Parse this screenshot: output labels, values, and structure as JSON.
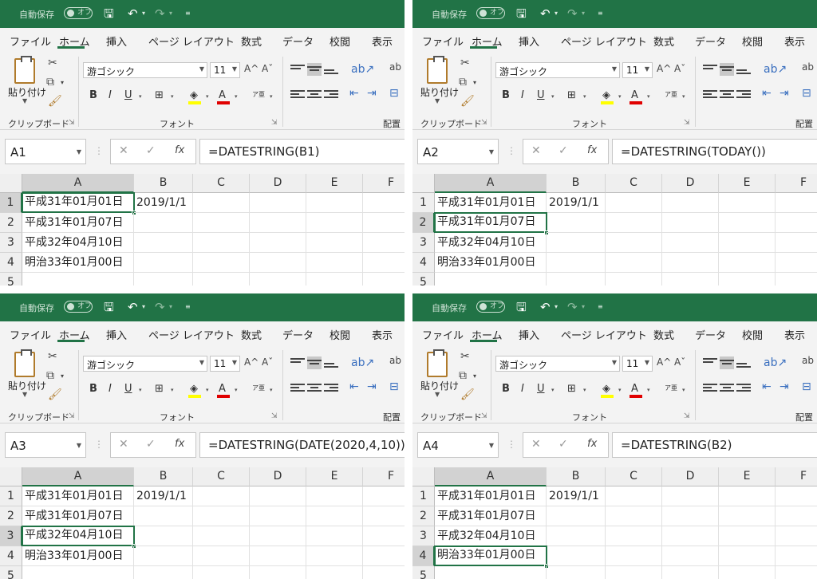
{
  "app": {
    "autosave_label": "自動保存",
    "autosave_state": "オフ",
    "tabs": [
      "ファイル",
      "ホーム",
      "挿入",
      "ページ レイアウト",
      "数式",
      "データ",
      "校閲",
      "表示"
    ],
    "paste_label": "貼り付け",
    "clipboard_group": "クリップボード",
    "font_group": "フォント",
    "align_group": "配置",
    "font_name": "游ゴシック",
    "font_size": "11",
    "bold": "B",
    "italic": "I",
    "underline": "U",
    "fx": "fx",
    "grow_font": "A^",
    "shrink_font": "Aˇ",
    "phonetic": "ア亜",
    "wrap_icon": "ab"
  },
  "columns": [
    "A",
    "B",
    "C",
    "D",
    "E",
    "F"
  ],
  "rows": [
    "1",
    "2",
    "3",
    "4",
    "5"
  ],
  "cells": {
    "a1": "平成31年01月01日",
    "a2": "平成31年01月07日",
    "a3": "平成32年04月10日",
    "a4": "明治33年01月00日",
    "b1": "2019/1/1"
  },
  "panels": [
    {
      "namebox": "A1",
      "formula": "=DATESTRING(B1)",
      "selected_row": 1
    },
    {
      "namebox": "A2",
      "formula": "=DATESTRING(TODAY())",
      "selected_row": 2
    },
    {
      "namebox": "A3",
      "formula": "=DATESTRING(DATE(2020,4,10))",
      "selected_row": 3
    },
    {
      "namebox": "A4",
      "formula": "=DATESTRING(B2)",
      "selected_row": 4
    }
  ],
  "colors": {
    "excel_green": "#217346",
    "font_color_red": "#e00000",
    "highlight_yellow": "#ffff00"
  }
}
